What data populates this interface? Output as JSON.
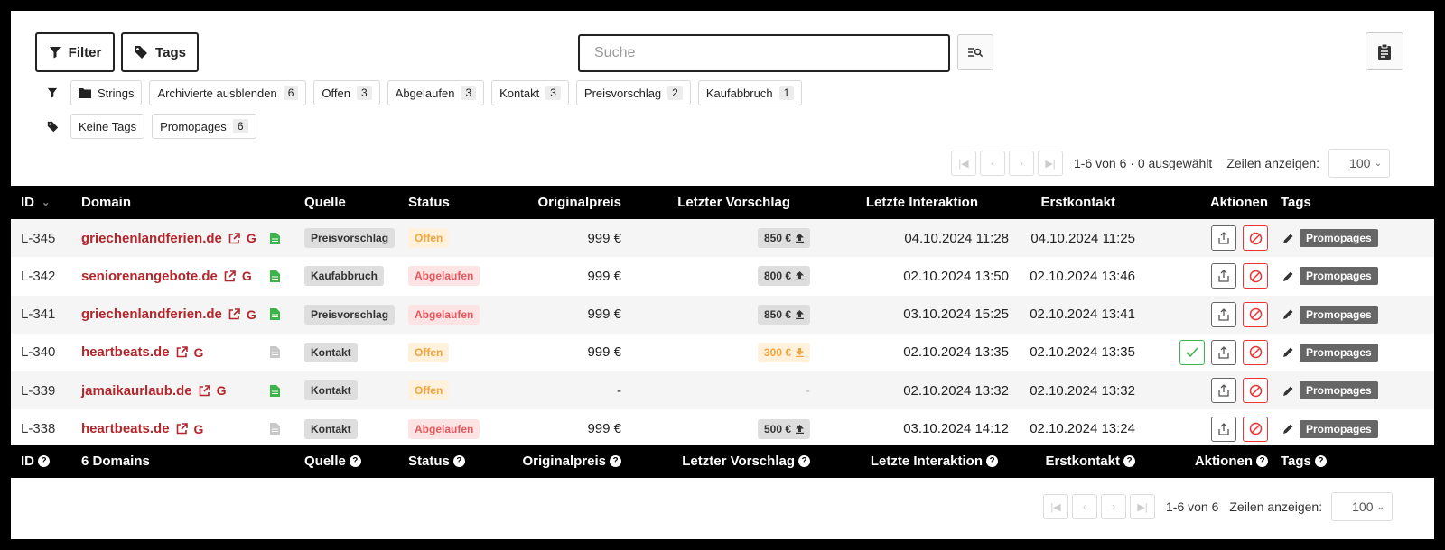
{
  "toolbar": {
    "filter_label": "Filter",
    "tags_label": "Tags",
    "search_placeholder": "Suche"
  },
  "filter_chips": [
    {
      "label": "Strings",
      "icon": "folder-icon"
    },
    {
      "label": "Archivierte ausblenden",
      "count": "6"
    },
    {
      "label": "Offen",
      "count": "3"
    },
    {
      "label": "Abgelaufen",
      "count": "3"
    },
    {
      "label": "Kontakt",
      "count": "3"
    },
    {
      "label": "Preisvorschlag",
      "count": "2"
    },
    {
      "label": "Kaufabbruch",
      "count": "1"
    }
  ],
  "tag_chips": [
    {
      "label": "Keine Tags"
    },
    {
      "label": "Promopages",
      "count": "6"
    }
  ],
  "pager_top": {
    "info": "1-6 von 6 · 0 ausgewählt",
    "rows_label": "Zeilen anzeigen:",
    "rows_value": "100"
  },
  "pager_bottom": {
    "info": "1-6 von 6",
    "rows_label": "Zeilen anzeigen:",
    "rows_value": "100"
  },
  "columns": {
    "id": "ID",
    "domain": "Domain",
    "source": "Quelle",
    "status": "Status",
    "price": "Originalpreis",
    "offer": "Letzter Vorschlag",
    "interaction": "Letzte Interaktion",
    "contact": "Erstkontakt",
    "actions": "Aktionen",
    "tags": "Tags"
  },
  "footer": {
    "id": "ID",
    "domain": "6 Domains",
    "source": "Quelle",
    "status": "Status",
    "price": "Originalpreis",
    "offer": "Letzter Vorschlag",
    "interaction": "Letzte Interaktion",
    "contact": "Erstkontakt",
    "actions": "Aktionen",
    "tags": "Tags"
  },
  "rows": [
    {
      "id": "L-345",
      "domain": "griechenlandferien.de",
      "doc_active": true,
      "source": "Preisvorschlag",
      "status": "Offen",
      "status_type": "offen",
      "price": "999 €",
      "offer": "850 €",
      "offer_dir": "up",
      "offer_highlight": false,
      "interaction": "04.10.2024 11:28",
      "contact": "04.10.2024 11:25",
      "accept": false,
      "tag": "Promopages"
    },
    {
      "id": "L-342",
      "domain": "seniorenangebote.de",
      "doc_active": true,
      "source": "Kaufabbruch",
      "status": "Abgelaufen",
      "status_type": "abg",
      "price": "999 €",
      "offer": "800 €",
      "offer_dir": "up",
      "offer_highlight": false,
      "interaction": "02.10.2024 13:50",
      "contact": "02.10.2024 13:46",
      "accept": false,
      "tag": "Promopages"
    },
    {
      "id": "L-341",
      "domain": "griechenlandferien.de",
      "doc_active": true,
      "source": "Preisvorschlag",
      "status": "Abgelaufen",
      "status_type": "abg",
      "price": "999 €",
      "offer": "850 €",
      "offer_dir": "up",
      "offer_highlight": false,
      "interaction": "03.10.2024 15:25",
      "contact": "02.10.2024 13:41",
      "accept": false,
      "tag": "Promopages"
    },
    {
      "id": "L-340",
      "domain": "heartbeats.de",
      "doc_active": false,
      "source": "Kontakt",
      "status": "Offen",
      "status_type": "offen",
      "price": "999 €",
      "offer": "300 €",
      "offer_dir": "down",
      "offer_highlight": true,
      "interaction": "02.10.2024 13:35",
      "contact": "02.10.2024 13:35",
      "accept": true,
      "tag": "Promopages"
    },
    {
      "id": "L-339",
      "domain": "jamaikaurlaub.de",
      "doc_active": true,
      "source": "Kontakt",
      "status": "Offen",
      "status_type": "offen",
      "price": "-",
      "offer": "-",
      "offer_dir": "",
      "offer_highlight": false,
      "interaction": "02.10.2024 13:32",
      "contact": "02.10.2024 13:32",
      "accept": false,
      "tag": "Promopages"
    },
    {
      "id": "L-338",
      "domain": "heartbeats.de",
      "doc_active": false,
      "source": "Kontakt",
      "status": "Abgelaufen",
      "status_type": "abg",
      "price": "999 €",
      "offer": "500 €",
      "offer_dir": "up",
      "offer_highlight": false,
      "interaction": "03.10.2024 14:12",
      "contact": "02.10.2024 13:24",
      "accept": false,
      "tag": "Promopages"
    }
  ],
  "colors": {
    "domain": "#b3262b",
    "doc_green": "#3bb54a",
    "block_red": "#e33333",
    "offen": "#f0a33a",
    "abgelaufen": "#e3585c"
  }
}
